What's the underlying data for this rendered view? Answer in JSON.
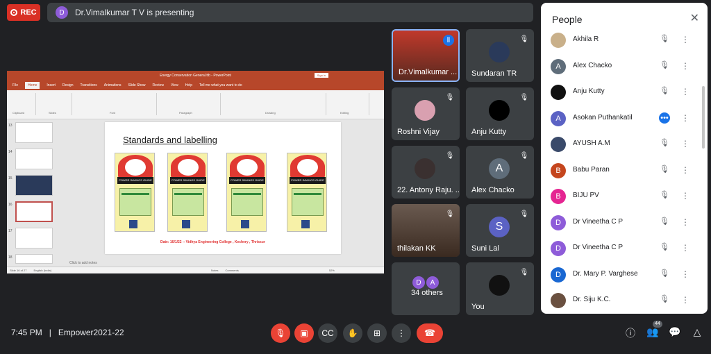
{
  "top": {
    "rec_label": "REC",
    "presenter_initial": "D",
    "presenting_text": "Dr.Vimalkumar T V is presenting"
  },
  "presentation": {
    "window_title": "Energy Conservation General.ttb - PowerPoint",
    "sign_in": "Sign in",
    "tabs": [
      "File",
      "Home",
      "Insert",
      "Design",
      "Transitions",
      "Animations",
      "Slide Show",
      "Review",
      "View",
      "Help",
      "Tell me what you want to do"
    ],
    "ribbon_groups": [
      "Clipboard",
      "Slides",
      "Font",
      "Paragraph",
      "Drawing",
      "Editing"
    ],
    "thumb_numbers": [
      "13",
      "14",
      "15",
      "16",
      "17",
      "18"
    ],
    "slide_title": "Standards and labelling",
    "label_text": "POWER SAVINGS GUIDE",
    "slide_footer": "Date: 16/1/22 -- Vidhya Engineering College , Kechery , Thrissur",
    "notes_placeholder": "Click to add notes",
    "status_left": "Slide 16 of 27",
    "status_lang": "English (India)",
    "status_notes": "Notes",
    "status_comments": "Comments",
    "zoom": "52%"
  },
  "tiles": [
    {
      "name": "Dr.Vimalkumar ...",
      "initial": "",
      "color": "#8a3a2a",
      "speaking": true
    },
    {
      "name": "Sundaran TR",
      "initial": "",
      "color": "#2a3a5a"
    },
    {
      "name": "Roshni Vijay",
      "initial": "",
      "color": "#d9a0b0"
    },
    {
      "name": "Anju Kutty",
      "initial": "",
      "color": "#000000"
    },
    {
      "name": "22. Antony Raju. ...",
      "initial": "",
      "color": "#3a3030"
    },
    {
      "name": "Alex Chacko",
      "initial": "A",
      "color": "#5f6d7a"
    },
    {
      "name": "thilakan KK",
      "initial": "",
      "color": "#5a4a40"
    },
    {
      "name": "Suni Lal",
      "initial": "S",
      "color": "#5b62c4"
    },
    {
      "name": "34 others",
      "initial": "",
      "color": ""
    },
    {
      "name": "You",
      "initial": "",
      "color": "#111111"
    }
  ],
  "others_avatars": [
    "D",
    "A"
  ],
  "people": {
    "header": "People",
    "list": [
      {
        "name": "Akhila R",
        "initial": "",
        "color": "#c9b08a"
      },
      {
        "name": "Alex Chacko",
        "initial": "A",
        "color": "#5f6d7a"
      },
      {
        "name": "Anju Kutty",
        "initial": "",
        "color": "#111111"
      },
      {
        "name": "Asokan Puthankatil",
        "initial": "A",
        "color": "#5b62c4",
        "speaking": true
      },
      {
        "name": "AYUSH A.M",
        "initial": "",
        "color": "#3a4a6a"
      },
      {
        "name": "Babu Paran",
        "initial": "B",
        "color": "#c5461e"
      },
      {
        "name": "BIJU PV",
        "initial": "B",
        "color": "#e52592"
      },
      {
        "name": "Dr Vineetha C P",
        "initial": "D",
        "color": "#8e5cd9"
      },
      {
        "name": "Dr Vineetha C P",
        "initial": "D",
        "color": "#8e5cd9"
      },
      {
        "name": "Dr. Mary P. Varghese",
        "initial": "D",
        "color": "#1967d2"
      },
      {
        "name": "Dr. Siju K.C.",
        "initial": "",
        "color": "#6a5040"
      }
    ]
  },
  "bottom": {
    "time": "7:45 PM",
    "separator": "|",
    "meeting_name": "Empower2021-22",
    "participants_count": "44"
  }
}
